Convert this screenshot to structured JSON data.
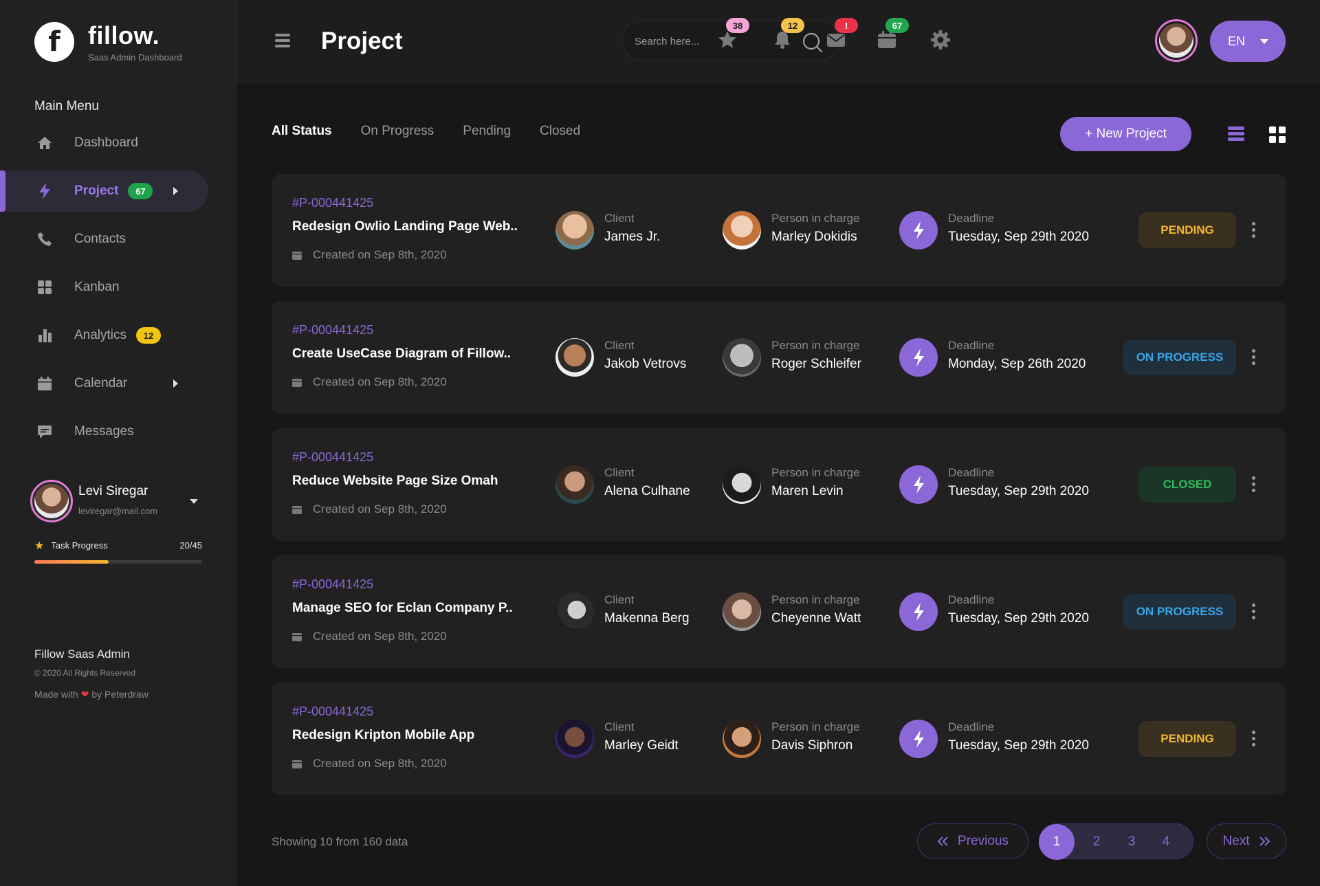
{
  "brand": {
    "name": "fillow.",
    "subtitle": "Saas Admin Dashboard",
    "logo_letter": "f"
  },
  "sidebar": {
    "menu_title": "Main Menu",
    "items": [
      {
        "label": "Dashboard",
        "icon": "home-icon"
      },
      {
        "label": "Project",
        "icon": "bolt-icon",
        "badge": "67",
        "active": true
      },
      {
        "label": "Contacts",
        "icon": "phone-icon"
      },
      {
        "label": "Kanban",
        "icon": "grid-icon"
      },
      {
        "label": "Analytics",
        "icon": "bar-chart-icon",
        "badge": "12"
      },
      {
        "label": "Calendar",
        "icon": "calendar-icon"
      },
      {
        "label": "Messages",
        "icon": "message-icon"
      }
    ],
    "profile": {
      "name": "Levi Siregar",
      "email": "leviregar@mail.com"
    },
    "task_progress": {
      "label": "Task Progress",
      "value": "20/45",
      "fraction": 0.444
    },
    "footer": {
      "title": "Fillow Saas Admin",
      "copyright": "© 2020 All Rights Reserved",
      "made_prefix": "Made with",
      "made_suffix": "by Peterdraw"
    }
  },
  "header": {
    "title": "Project",
    "search_placeholder": "Search here...",
    "badges": {
      "star": "38",
      "bell": "12",
      "mail": "!",
      "calendar": "67"
    },
    "language": "EN"
  },
  "filters": {
    "tabs": [
      "All Status",
      "On Progress",
      "Pending",
      "Closed"
    ],
    "active": "All Status"
  },
  "new_project_label": "+ New Project",
  "projects": [
    {
      "id": "#P-000441425",
      "title": "Redesign Owlio Landing Page Web..",
      "created": "Created on Sep 8th, 2020",
      "client_label": "Client",
      "client": "James Jr.",
      "pic_label": "Person in charge",
      "pic": "Marley Dokidis",
      "deadline_label": "Deadline",
      "deadline": "Tuesday,  Sep 29th 2020",
      "status": "PENDING"
    },
    {
      "id": "#P-000441425",
      "title": "Create UseCase Diagram of Fillow..",
      "created": "Created on Sep 8th, 2020",
      "client_label": "Client",
      "client": "Jakob Vetrovs",
      "pic_label": "Person in charge",
      "pic": "Roger Schleifer",
      "deadline_label": "Deadline",
      "deadline": "Monday,  Sep 26th 2020",
      "status": "ON PROGRESS"
    },
    {
      "id": "#P-000441425",
      "title": "Reduce Website Page Size Omah",
      "created": "Created on Sep 8th, 2020",
      "client_label": "Client",
      "client": "Alena Culhane",
      "pic_label": "Person in charge",
      "pic": "Maren Levin",
      "deadline_label": "Deadline",
      "deadline": "Tuesday,  Sep 29th 2020",
      "status": "CLOSED"
    },
    {
      "id": "#P-000441425",
      "title": "Manage SEO for Eclan Company P..",
      "created": "Created on Sep 8th, 2020",
      "client_label": "Client",
      "client": "Makenna Berg",
      "pic_label": "Person in charge",
      "pic": "Cheyenne Watt",
      "deadline_label": "Deadline",
      "deadline": "Tuesday,  Sep 29th 2020",
      "status": "ON PROGRESS"
    },
    {
      "id": "#P-000441425",
      "title": "Redesign Kripton Mobile App",
      "created": "Created on Sep 8th, 2020",
      "client_label": "Client",
      "client": "Marley Geidt",
      "pic_label": "Person in charge",
      "pic": "Davis Siphron",
      "deadline_label": "Deadline",
      "deadline": "Tuesday,  Sep 29th 2020",
      "status": "PENDING"
    }
  ],
  "pagination": {
    "showing": "Showing 10 from 160 data",
    "previous": "Previous",
    "next": "Next",
    "pages": [
      "1",
      "2",
      "3",
      "4"
    ],
    "current": "1"
  },
  "colors": {
    "accent": "#8c67d8",
    "pending": "#f5b82e",
    "progress": "#35a7e8",
    "closed": "#2dbc5c"
  }
}
